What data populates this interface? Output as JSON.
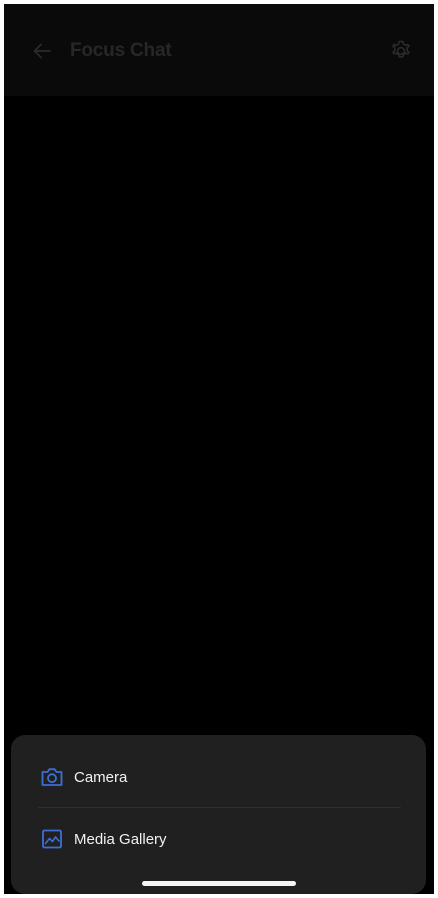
{
  "header": {
    "title": "Focus Chat",
    "back_icon": "arrow-left-icon",
    "settings_icon": "gear-icon"
  },
  "sheet": {
    "items": [
      {
        "label": "Camera",
        "icon": "camera-icon"
      },
      {
        "label": "Media Gallery",
        "icon": "image-icon"
      }
    ]
  },
  "colors": {
    "background": "#000000",
    "sheet_background": "#202020",
    "accent": "#3d6fd6",
    "header_text": "#272727"
  }
}
